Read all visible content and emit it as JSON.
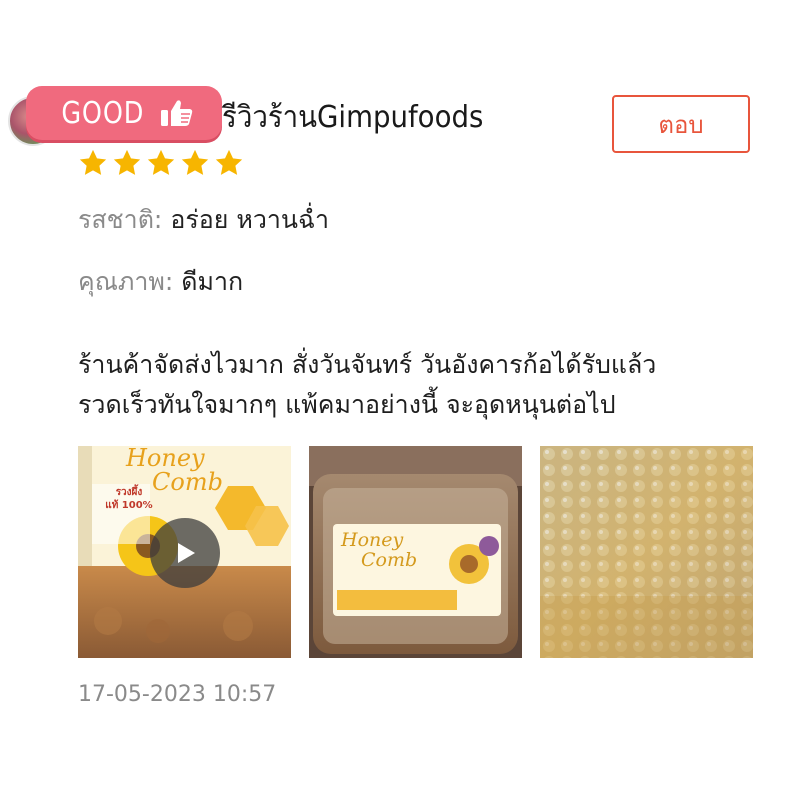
{
  "review": {
    "badge_text": "GOOD",
    "reviewer_name": "รีวิวร้านGimpufoods",
    "reply_label": "ตอบ",
    "rating": 5,
    "rating_max": 5,
    "star_color": "#f7b500",
    "accent_color": "#e8553c",
    "badge_color": "#f06a7e",
    "attributes": [
      {
        "label": "รสชาติ:",
        "value": "อร่อย หวานฉ่ำ"
      },
      {
        "label": "คุณภาพ:",
        "value": "ดีมาก"
      }
    ],
    "text_lines": [
      "ร้านค้าจัดส่งไวมาก สั่งวันจันทร์ วันอังคารก้อได้รับแล้ว",
      "รวดเร็วทันใจมากๆ แพ้คมาอย่างนี้ จะอุดหนุนต่อไป"
    ],
    "media": [
      {
        "type": "video",
        "label_lines": [
          "Honey",
          "Comb"
        ],
        "tag_lines": [
          "รวงผึ้ง",
          "แท้ 100%"
        ],
        "play_icon": "play-icon"
      },
      {
        "type": "image",
        "label_lines": [
          "Honey",
          "Comb"
        ]
      },
      {
        "type": "image"
      }
    ],
    "timestamp": "17-05-2023 10:57"
  }
}
